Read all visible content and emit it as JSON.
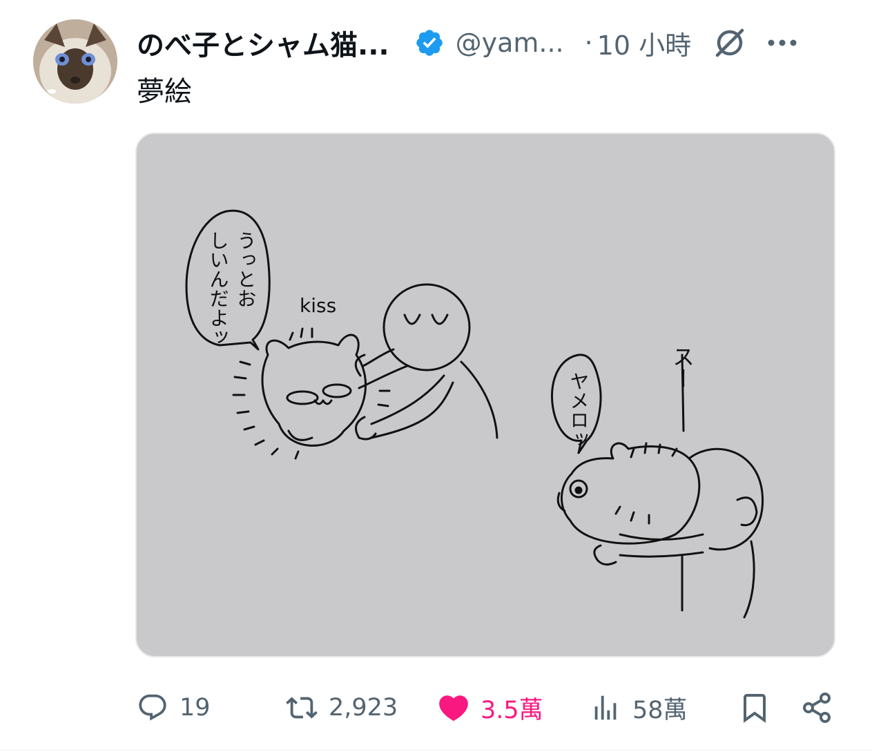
{
  "author": {
    "display_name": "のべ子とシャム猫...",
    "handle": "@yam...",
    "verified": true,
    "verified_icon": "verified-badge-icon",
    "avatar_icon": "siamese-cat-avatar"
  },
  "meta": {
    "separator": "·",
    "timestamp": "10 小時"
  },
  "tweet": {
    "text": "夢絵"
  },
  "media": {
    "speech_bubble_left": [
      "うっとお",
      "しいんだよッ"
    ],
    "kiss_label": "kiss",
    "speech_bubble_right": "ヤメロッ",
    "sfx": "スー"
  },
  "actions": {
    "reply": {
      "icon": "reply-icon",
      "count": "19"
    },
    "repost": {
      "icon": "repost-icon",
      "count": "2,923"
    },
    "like": {
      "icon": "heart-icon",
      "count": "3.5萬",
      "color": "#f91880"
    },
    "views": {
      "icon": "views-icon",
      "count": "58萬"
    },
    "bookmark": {
      "icon": "bookmark-icon"
    },
    "share": {
      "icon": "share-icon"
    }
  },
  "colors": {
    "text_primary": "#0f1419",
    "text_secondary": "#536471",
    "verified_blue": "#1d9bf0",
    "like_pink": "#f91880"
  }
}
